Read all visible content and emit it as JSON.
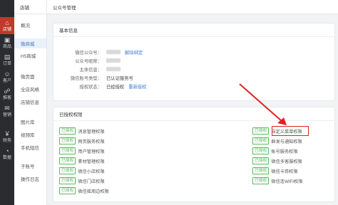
{
  "nav": {
    "items": [
      {
        "label": "店铺",
        "icon": "home-icon",
        "active": true
      },
      {
        "label": "商品",
        "icon": "box-icon"
      },
      {
        "label": "订单",
        "icon": "order-icon"
      },
      {
        "label": "客户",
        "icon": "user-icon"
      },
      {
        "label": "推客",
        "icon": "share-icon"
      },
      {
        "label": "营销",
        "icon": "gift-icon"
      },
      {
        "label": "财务",
        "icon": "finance-icon"
      },
      {
        "label": "数据",
        "icon": "chart-icon"
      }
    ]
  },
  "subnav": {
    "header": "店铺",
    "items": [
      {
        "label": "概况"
      },
      {
        "label": "微商城",
        "active": true
      },
      {
        "label": "H5商城"
      },
      {
        "label": "微页面"
      },
      {
        "label": "全店风格"
      },
      {
        "label": "店铺信息"
      },
      {
        "label": "图片库"
      },
      {
        "label": "视频库"
      },
      {
        "label": "手机短信"
      },
      {
        "label": "子账号"
      },
      {
        "label": "操作日志"
      }
    ]
  },
  "topbar": {
    "title": "公众号管理"
  },
  "basic_info": {
    "title": "基本信息",
    "rows": [
      {
        "label": "微信公众号：",
        "value": "",
        "blurred": true,
        "link": "解除绑定"
      },
      {
        "label": "公众号昵称：",
        "value": "",
        "blurred": true
      },
      {
        "label": "主体信息：",
        "value": "",
        "blurred": true
      },
      {
        "label": "微信账号类型：",
        "value": "已认证服务号"
      },
      {
        "label": "授权状态：",
        "value": "已经授权",
        "link": "重新授权"
      }
    ]
  },
  "permissions": {
    "title": "已授权权限",
    "badge": "已授权",
    "left": [
      "消息管理权限",
      "网页服务权限",
      "用户管理权限",
      "素材管理权限",
      "微信小店权限",
      "微信门店权限",
      "微信摇周边权限"
    ],
    "right": [
      "自定义菜单权限",
      "群发与通知权限",
      "账号服务权限",
      "微信多客服权限",
      "微信卡券权限",
      "微信连WIFI权限"
    ]
  }
}
